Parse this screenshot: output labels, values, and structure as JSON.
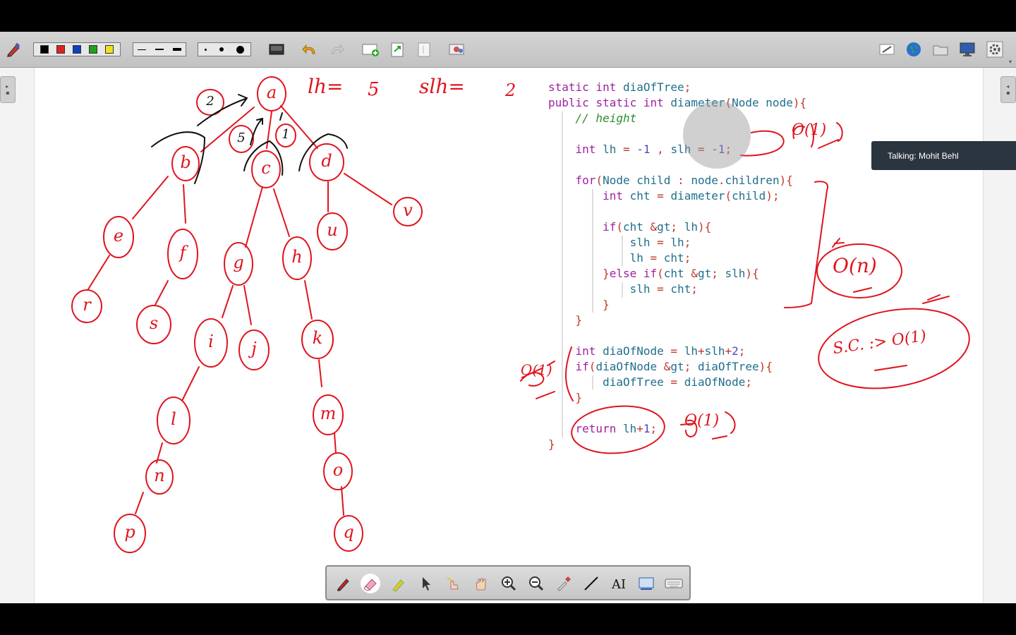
{
  "toolbar": {
    "colors": [
      "#000000",
      "#e02020",
      "#1040c0",
      "#20a020",
      "#f0e020"
    ],
    "tools": [
      "pen-settings",
      "color-palette",
      "line-widths",
      "dot-sizes",
      "screen-icon",
      "undo-icon",
      "redo-icon",
      "add-page-icon",
      "page-next-icon",
      "page-icon",
      "gallery-icon",
      "whiteboard-icon",
      "globe-icon",
      "folder-icon",
      "monitor-icon",
      "settings-icon"
    ]
  },
  "talking": "Talking: Mohit Behl",
  "code": {
    "lines": [
      "static int diaOfTree;",
      "public static int diameter(Node node){",
      "    // height",
      "",
      "    int lh = -1 , slh = -1;",
      "",
      "    for(Node child : node.children){",
      "        int cht = diameter(child);",
      "",
      "        if(cht > lh){",
      "            slh = lh;",
      "            lh = cht;",
      "        }else if(cht > slh){",
      "            slh = cht;",
      "        }",
      "    }",
      "",
      "    int diaOfNode = lh+slh+2;",
      "    if(diaOfNode > diaOfTree){",
      "        diaOfTree = diaOfNode;",
      "    }",
      "",
      "    return lh+1;",
      "}"
    ]
  },
  "annotations": {
    "lh_label": "lh=",
    "lh_value": "5",
    "slh_label": "slh=",
    "slh_value": "2",
    "o1_a": "O(1)",
    "on": "O(n)",
    "sc": "S.C. :> O(1)",
    "o1_b": "O(1)",
    "o1_c": "O(1)"
  },
  "tree": {
    "nodes": [
      "a",
      "b",
      "c",
      "d",
      "e",
      "f",
      "g",
      "h",
      "u",
      "v",
      "r",
      "s",
      "i",
      "j",
      "k",
      "l",
      "m",
      "n",
      "o",
      "p",
      "q"
    ],
    "edge_labels": [
      "2",
      "5",
      "1"
    ]
  },
  "bottom_tools": [
    "pen-icon",
    "eraser-icon",
    "highlighter-icon",
    "pointer-icon",
    "spotlight-icon",
    "hand-icon",
    "zoom-in-icon",
    "zoom-out-icon",
    "eyedropper-icon",
    "line-icon",
    "text-icon",
    "screenshot-icon",
    "keyboard-icon"
  ]
}
